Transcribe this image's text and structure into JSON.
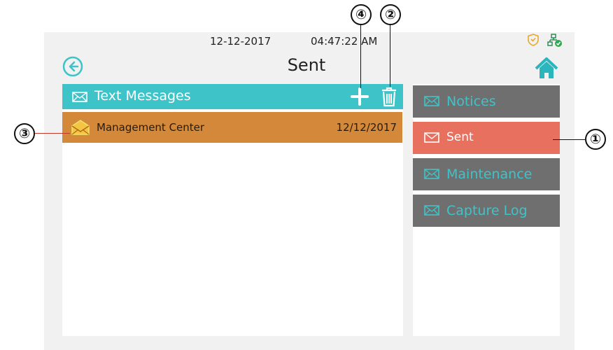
{
  "status_bar": {
    "date": "12-12-2017",
    "time": "04:47:22 AM"
  },
  "header": {
    "title": "Sent"
  },
  "messages_panel": {
    "title": "Text Messages",
    "rows": [
      {
        "sender": "Management Center",
        "date": "12/12/2017"
      }
    ]
  },
  "nav": {
    "items": [
      {
        "label": "Notices"
      },
      {
        "label": "Sent",
        "active": true
      },
      {
        "label": "Maintenance"
      },
      {
        "label": "Capture Log"
      }
    ]
  },
  "callouts": {
    "c1": "①",
    "c2": "②",
    "c3": "③",
    "c4": "④"
  },
  "colors": {
    "teal": "#3ec3c9",
    "active_row": "#d4893a",
    "active_nav": "#e8705f",
    "nav_gray": "#6f6f6f"
  }
}
